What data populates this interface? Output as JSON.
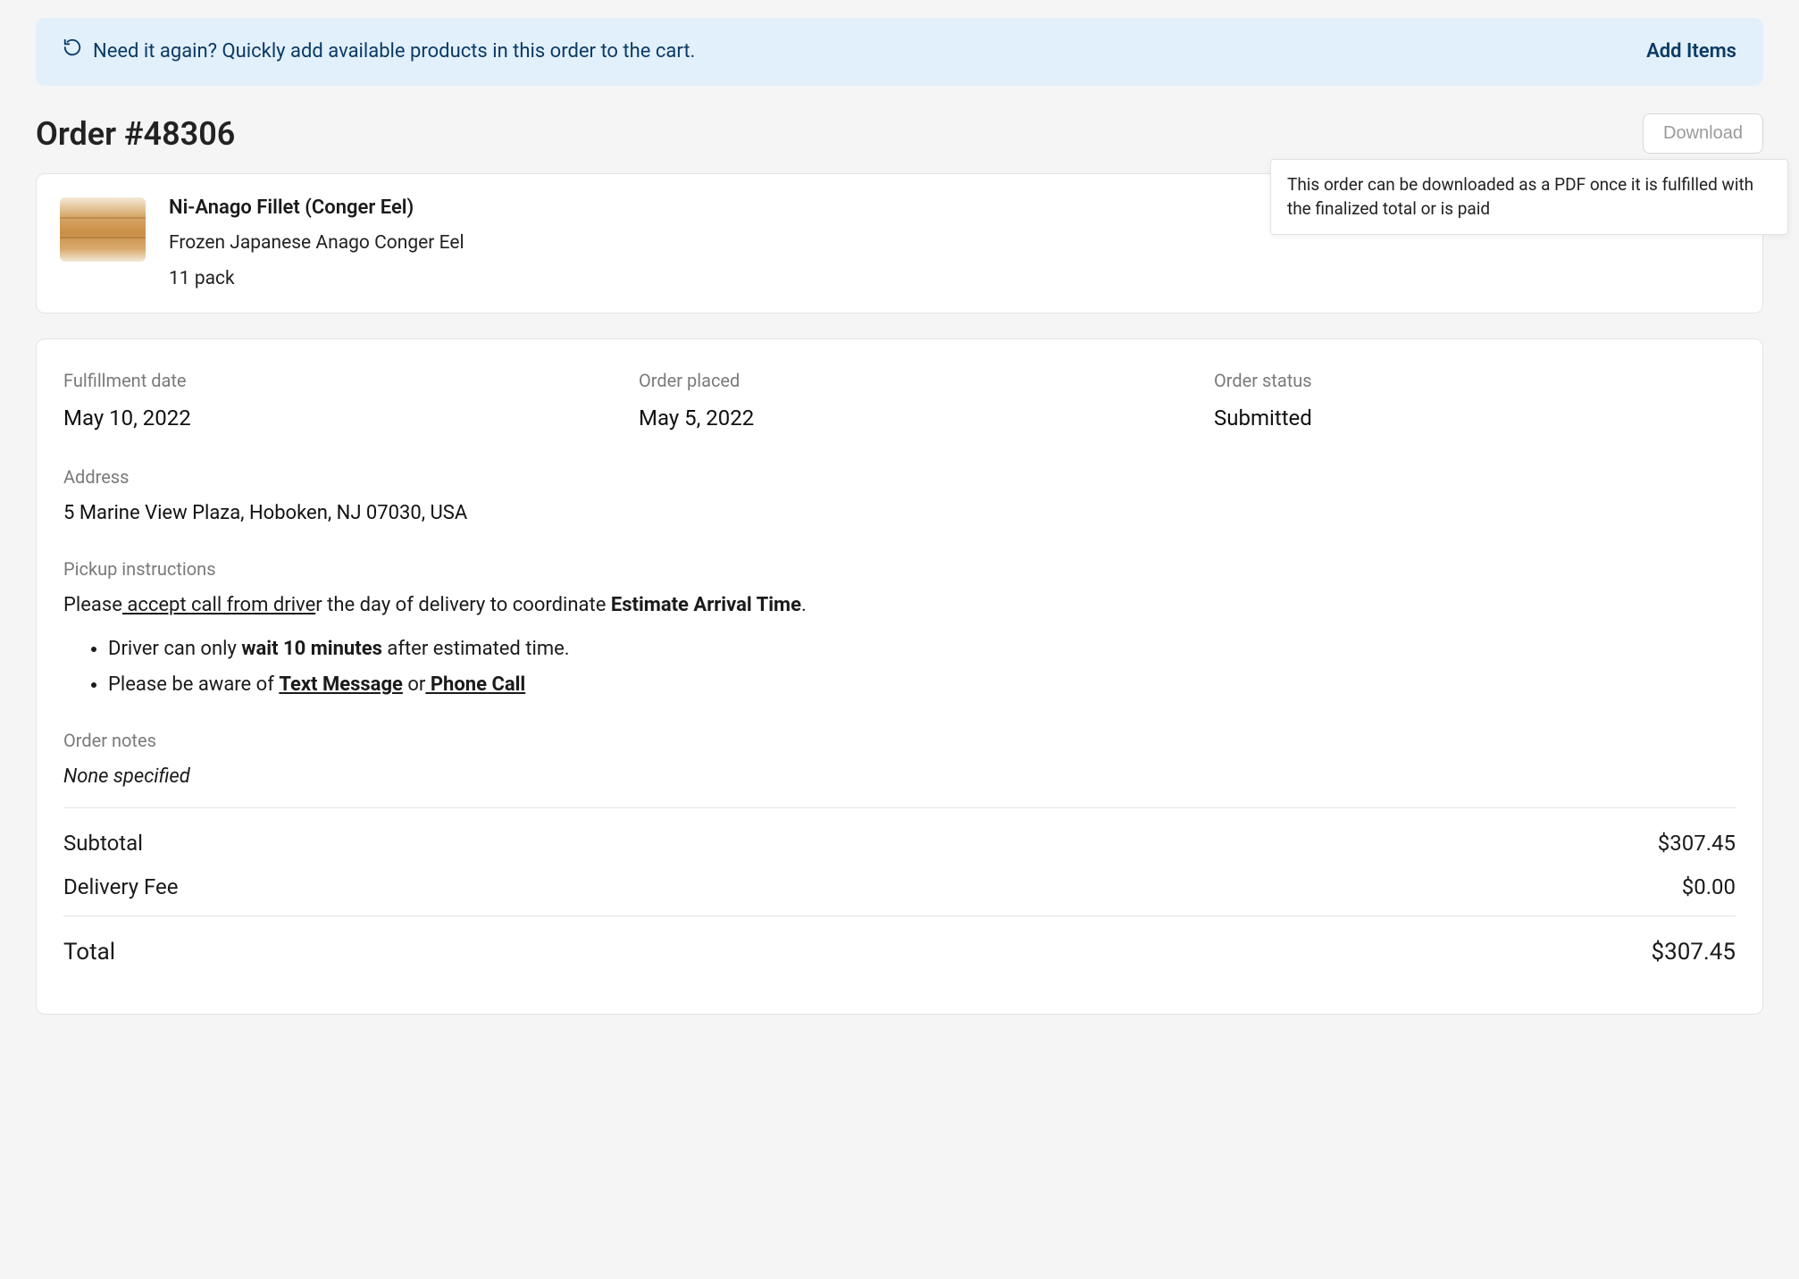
{
  "banner": {
    "text": "Need it again? Quickly add available products in this order to the cart.",
    "action": "Add Items"
  },
  "title": "Order #48306",
  "download": {
    "label": "Download",
    "tooltip": "This order can be downloaded as a PDF once it is fulfilled with the finalized total or is paid"
  },
  "line_item": {
    "name": "Ni-Anago Fillet (Conger Eel)",
    "desc": "Frozen Japanese Anago Conger Eel",
    "qty": "11 pack"
  },
  "labels": {
    "fulfillment_date": "Fulfillment date",
    "order_placed": "Order placed",
    "order_status": "Order status",
    "address": "Address",
    "pickup_instructions": "Pickup instructions",
    "order_notes": "Order notes",
    "subtotal": "Subtotal",
    "delivery_fee": "Delivery Fee",
    "total": "Total"
  },
  "details": {
    "fulfillment_date": "May 10, 2022",
    "order_placed": "May 5, 2022",
    "order_status": "Submitted",
    "address": "5 Marine View Plaza, Hoboken, NJ 07030, USA",
    "order_notes": "None specified"
  },
  "instructions": {
    "prefix": "Please",
    "uline": " accept call from drive",
    "mid1": "r the day of delivery to coordinate ",
    "bold1": "Estimate Arrival Time",
    "suffix1": ".",
    "b1_a": "Driver can only ",
    "b1_b": "wait 10 minutes",
    "b1_c": " after estimated time.",
    "b2_a": "Please be aware of ",
    "b2_b": "Text Message",
    "b2_c": " or",
    "b2_d": " Phone Call"
  },
  "totals": {
    "subtotal": "$307.45",
    "delivery_fee": "$0.00",
    "total": "$307.45"
  }
}
